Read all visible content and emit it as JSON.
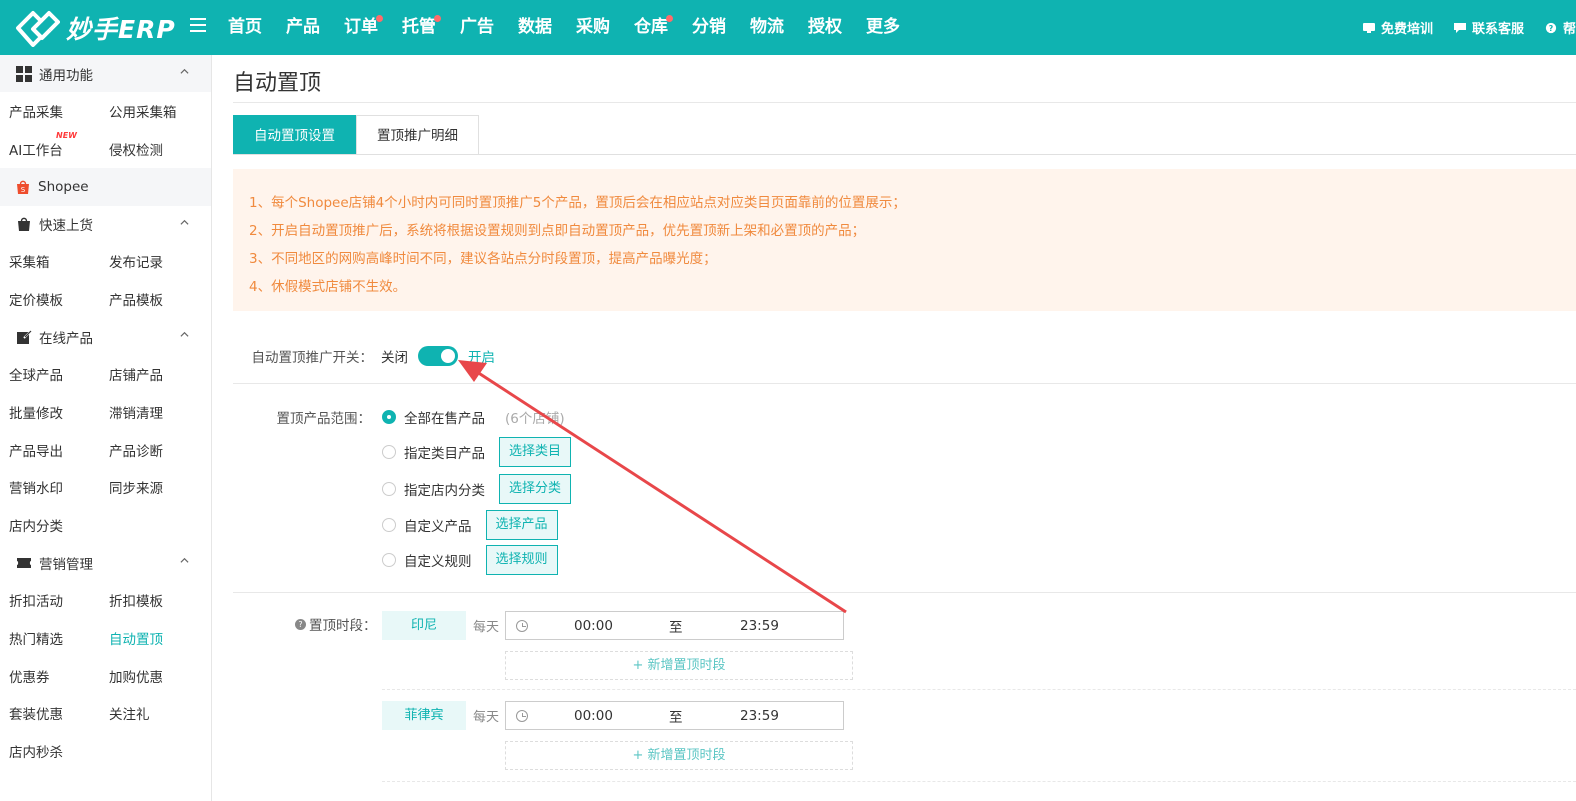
{
  "app": {
    "logo_text": "妙手ERP",
    "accent_color": "#0fb3b1"
  },
  "topnav": {
    "items": [
      {
        "label": "首页",
        "dot": false
      },
      {
        "label": "产品",
        "dot": false
      },
      {
        "label": "订单",
        "dot": true
      },
      {
        "label": "托管",
        "dot": true
      },
      {
        "label": "广告",
        "dot": false
      },
      {
        "label": "数据",
        "dot": false
      },
      {
        "label": "采购",
        "dot": false
      },
      {
        "label": "仓库",
        "dot": true
      },
      {
        "label": "分销",
        "dot": false
      },
      {
        "label": "物流",
        "dot": false
      },
      {
        "label": "授权",
        "dot": false
      },
      {
        "label": "更多",
        "dot": false
      }
    ],
    "right": {
      "training": "免费培训",
      "support": "联系客服",
      "help": "帮"
    }
  },
  "sidebar": {
    "general": {
      "label": "通用功能",
      "items": [
        "产品采集",
        "公用采集箱",
        "AI工作台",
        "侵权检测"
      ],
      "new_badge": "NEW"
    },
    "platform": "Shopee",
    "quick": {
      "label": "快速上货",
      "items": [
        "采集箱",
        "发布记录",
        "定价模板",
        "产品模板"
      ]
    },
    "online": {
      "label": "在线产品",
      "items": [
        "全球产品",
        "店铺产品",
        "批量修改",
        "滞销清理",
        "产品导出",
        "产品诊断",
        "营销水印",
        "同步来源",
        "店内分类"
      ]
    },
    "marketing": {
      "label": "营销管理",
      "items": [
        "折扣活动",
        "折扣模板",
        "热门精选",
        "自动置顶",
        "优惠券",
        "加购优惠",
        "套装优惠",
        "关注礼",
        "店内秒杀"
      ]
    }
  },
  "main": {
    "title": "自动置顶",
    "tabs": [
      "自动置顶设置",
      "置顶推广明细"
    ],
    "notices": [
      "1、每个Shopee店铺4个小时内可同时置顶推广5个产品，置顶后会在相应站点对应类目页面靠前的位置展示；",
      "2、开启自动置顶推广后，系统将根据设置规则到点即自动置顶产品，优先置顶新上架和必置顶的产品；",
      "3、不同地区的网购高峰时间不同，建议各站点分时段置顶，提高产品曝光度；",
      "4、休假模式店铺不生效。"
    ],
    "switch": {
      "label": "自动置顶推广开关：",
      "off": "关闭",
      "on": "开启",
      "enabled": true
    },
    "range": {
      "label": "置顶产品范围：",
      "options": [
        {
          "label": "全部在售产品",
          "hint": "(6个店铺)",
          "button": "",
          "selected": true
        },
        {
          "label": "指定类目产品",
          "hint": "",
          "button": "选择类目",
          "selected": false
        },
        {
          "label": "指定店内分类",
          "hint": "",
          "button": "选择分类",
          "selected": false
        },
        {
          "label": "自定义产品",
          "hint": "",
          "button": "选择产品",
          "selected": false
        },
        {
          "label": "自定义规则",
          "hint": "",
          "button": "选择规则",
          "selected": false
        }
      ]
    },
    "schedule": {
      "label": "置顶时段：",
      "everyday": "每天",
      "separator": "至",
      "add_label": "+ 新增置顶时段",
      "sites": [
        {
          "name": "印尼",
          "start": "00:00",
          "end": "23:59"
        },
        {
          "name": "菲律宾",
          "start": "00:00",
          "end": "23:59"
        }
      ]
    }
  }
}
